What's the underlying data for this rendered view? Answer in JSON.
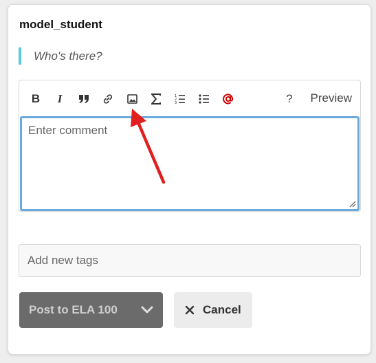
{
  "post": {
    "username": "model_student",
    "quote": "Who's there?"
  },
  "toolbar": {
    "buttons": [
      {
        "name": "bold",
        "glyph": "B"
      },
      {
        "name": "italic",
        "glyph": "I"
      },
      {
        "name": "quote",
        "icon": "quote-icon"
      },
      {
        "name": "link",
        "icon": "link-icon"
      },
      {
        "name": "image",
        "icon": "image-icon"
      },
      {
        "name": "math",
        "icon": "sigma-icon"
      },
      {
        "name": "ordered-list",
        "icon": "ordered-list-icon"
      },
      {
        "name": "bullet-list",
        "icon": "bullet-list-icon"
      },
      {
        "name": "mention",
        "icon": "at-icon",
        "color": "#cc0000"
      },
      {
        "name": "help",
        "glyph": "?"
      }
    ],
    "preview_label": "Preview"
  },
  "editor": {
    "placeholder": "Enter comment"
  },
  "tags": {
    "placeholder": "Add new tags"
  },
  "actions": {
    "post_label": "Post to ELA 100",
    "cancel_label": "Cancel"
  },
  "colors": {
    "focus_border": "#6aa9dc",
    "quote_bar": "#5bc8e6",
    "mention": "#cc0000",
    "annotation_arrow": "#e02020",
    "post_button_bg": "#6b6b6b"
  }
}
